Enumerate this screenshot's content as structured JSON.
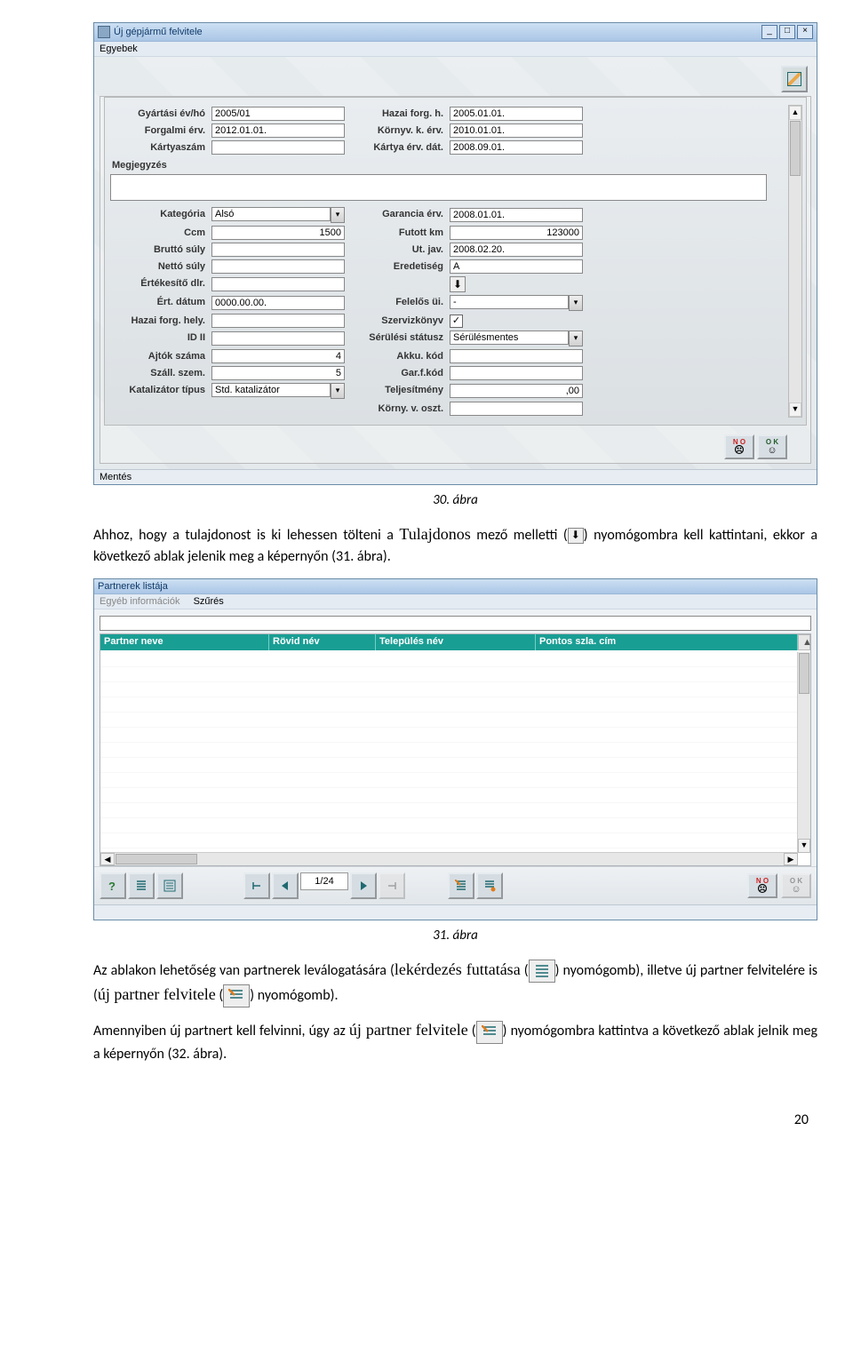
{
  "win1": {
    "title": "Új gépjármű felvitele",
    "menu": "Egyebek",
    "status": "Mentés",
    "btn_no": "N O",
    "btn_ok": "O K",
    "fields": {
      "gyartasi": {
        "label": "Gyártási év/hó",
        "value": "2005/01"
      },
      "hazai_forg_h": {
        "label": "Hazai forg. h.",
        "value": "2005.01.01."
      },
      "forgalmi": {
        "label": "Forgalmi érv.",
        "value": "2012.01.01."
      },
      "kornyv_k": {
        "label": "Környv. k. érv.",
        "value": "2010.01.01."
      },
      "kartyaszam": {
        "label": "Kártyaszám",
        "value": ""
      },
      "kartya_erv": {
        "label": "Kártya érv. dát.",
        "value": "2008.09.01."
      },
      "megjegyzes": {
        "label": "Megjegyzés",
        "value": ""
      },
      "kategoria": {
        "label": "Kategória",
        "value": "Alsó"
      },
      "garancia": {
        "label": "Garancia érv.",
        "value": "2008.01.01."
      },
      "ccm": {
        "label": "Ccm",
        "value": "1500"
      },
      "futott": {
        "label": "Futott km",
        "value": "123000"
      },
      "brutto": {
        "label": "Bruttó súly",
        "value": ""
      },
      "utjav": {
        "label": "Ut. jav.",
        "value": "2008.02.20."
      },
      "netto": {
        "label": "Nettó súly",
        "value": ""
      },
      "eredetiseg": {
        "label": "Eredetiség",
        "value": "A"
      },
      "ertdlr": {
        "label": "Értékesítő dlr.",
        "value": ""
      },
      "ertdatum": {
        "label": "Ért. dátum",
        "value": "0000.00.00."
      },
      "felelos": {
        "label": "Felelős üi.",
        "value": "-"
      },
      "hazaiforg_hely": {
        "label": "Hazai forg. hely.",
        "value": ""
      },
      "szervizkonyv": {
        "label": "Szervizkönyv",
        "checked": true
      },
      "id2": {
        "label": "ID II",
        "value": ""
      },
      "serulesi": {
        "label": "Sérülési státusz",
        "value": "Sérülésmentes"
      },
      "ajtok": {
        "label": "Ajtók száma",
        "value": "4"
      },
      "akku": {
        "label": "Akku. kód",
        "value": ""
      },
      "szall": {
        "label": "Száll. szem.",
        "value": "5"
      },
      "garfkod": {
        "label": "Gar.f.kód",
        "value": ""
      },
      "katal": {
        "label": "Katalizátor típus",
        "value": "Std. katalizátor"
      },
      "teljes": {
        "label": "Teljesítmény",
        "value": ",00"
      },
      "kornyosz": {
        "label": "Körny. v. oszt.",
        "value": ""
      }
    }
  },
  "caption1": "30. ábra",
  "para1a": "Ahhoz, hogy a tulajdonost is ki lehessen tölteni a ",
  "para1b": "Tulajdonos",
  "para1c": " mező melletti (",
  "para1d": ") nyomógombra kell kattintani, ekkor a következő ablak jelenik meg a képernyőn (31. ábra).",
  "win2": {
    "title": "Partnerek listája",
    "menu1": "Egyéb információk",
    "menu2": "Szűrés",
    "cols": {
      "c1": "Partner neve",
      "c2": "Rövid név",
      "c3": "Település név",
      "c4": "Pontos szla. cím"
    },
    "pager": "1/24",
    "btn_no": "N O",
    "btn_ok": "O K"
  },
  "caption2": "31. ábra",
  "para2a": "Az ablakon lehetőség van partnerek leválogatására (",
  "para2b": "lekérdezés futtatása",
  "para2c": " (",
  "para2d": ") nyomógomb), illetve új partner felvitelére is (",
  "para2e": "új partner felvitele",
  "para2f": " (",
  "para2g": ") nyomógomb).",
  "para3a": "Amennyiben új partnert kell felvinni, úgy az ",
  "para3b": "új partner felvitele",
  "para3c": " (",
  "para3d": ") nyomógombra kattintva a következő ablak jelnik meg a képernyőn (32. ábra).",
  "pageNum": "20"
}
